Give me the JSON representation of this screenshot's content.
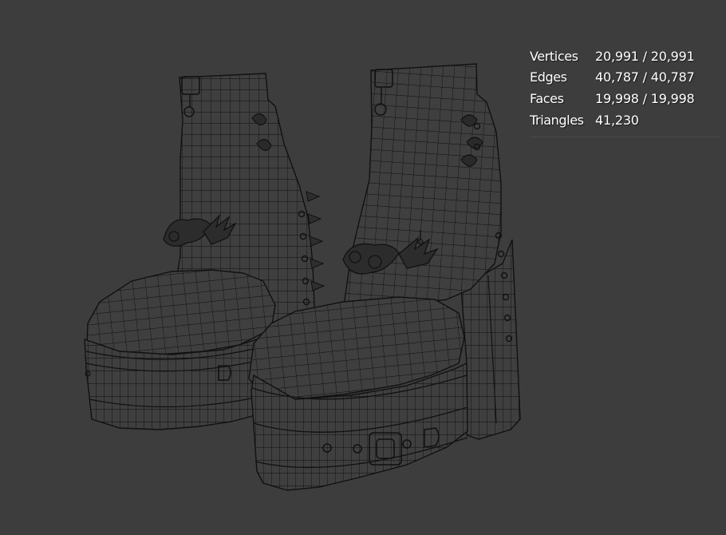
{
  "viewport": {
    "background": "#3d3d3d",
    "wire_color": "#0e0e0e",
    "solid_color": "#3f3f3f"
  },
  "stats": {
    "rows": [
      {
        "label": "Vertices",
        "value": "20,991 / 20,991"
      },
      {
        "label": "Edges",
        "value": "40,787 / 40,787"
      },
      {
        "label": "Faces",
        "value": "19,998 / 19,998"
      },
      {
        "label": "Triangles",
        "value": "41,230"
      }
    ]
  },
  "model": {
    "icon": "platform-boots-wireframe-mesh"
  }
}
